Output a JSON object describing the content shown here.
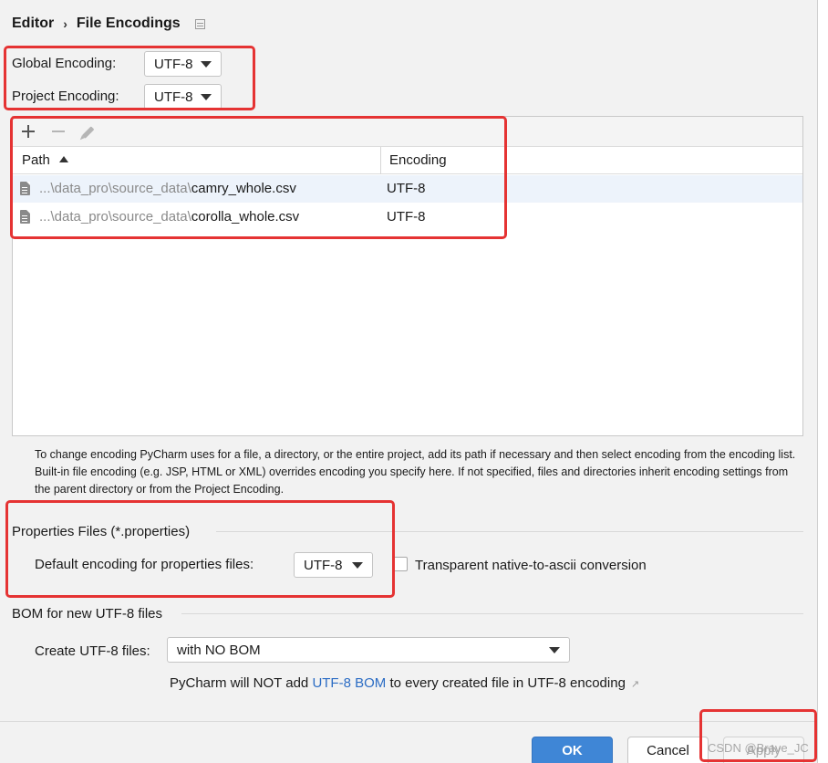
{
  "breadcrumb": {
    "parent": "Editor",
    "separator": "›",
    "current": "File Encodings"
  },
  "global": {
    "label": "Global Encoding:",
    "value": "UTF-8"
  },
  "project": {
    "label": "Project Encoding:",
    "value": "UTF-8"
  },
  "table": {
    "columns": [
      "Path",
      "Encoding"
    ],
    "rows": [
      {
        "path_prefix": "...\\data_pro\\source_data\\",
        "file": "camry_whole.csv",
        "encoding": "UTF-8"
      },
      {
        "path_prefix": "...\\data_pro\\source_data\\",
        "file": "corolla_whole.csv",
        "encoding": "UTF-8"
      }
    ]
  },
  "help_text": "To change encoding PyCharm uses for a file, a directory, or the entire project, add its path if necessary and then select encoding from the encoding list. Built-in file encoding (e.g. JSP, HTML or XML) overrides encoding you specify here. If not specified, files and directories inherit encoding settings from the parent directory or from the Project Encoding.",
  "properties": {
    "section_title": "Properties Files (*.properties)",
    "default_label": "Default encoding for properties files:",
    "default_value": "UTF-8",
    "native_label": "Transparent native-to-ascii conversion"
  },
  "bom": {
    "section_title": "BOM for new UTF-8 files",
    "create_label": "Create UTF-8 files:",
    "create_value": "with NO BOM",
    "note_before": "PyCharm will NOT add ",
    "note_link": "UTF-8 BOM",
    "note_after": " to every created file in UTF-8 encoding",
    "note_arrow": "↗"
  },
  "buttons": {
    "ok": "OK",
    "cancel": "Cancel",
    "apply": "Apply"
  },
  "watermark": "CSDN @Brave_JC",
  "colors": {
    "highlight_box": "#e53333",
    "primary_button": "#3f86d6",
    "link": "#2b6cc4"
  }
}
